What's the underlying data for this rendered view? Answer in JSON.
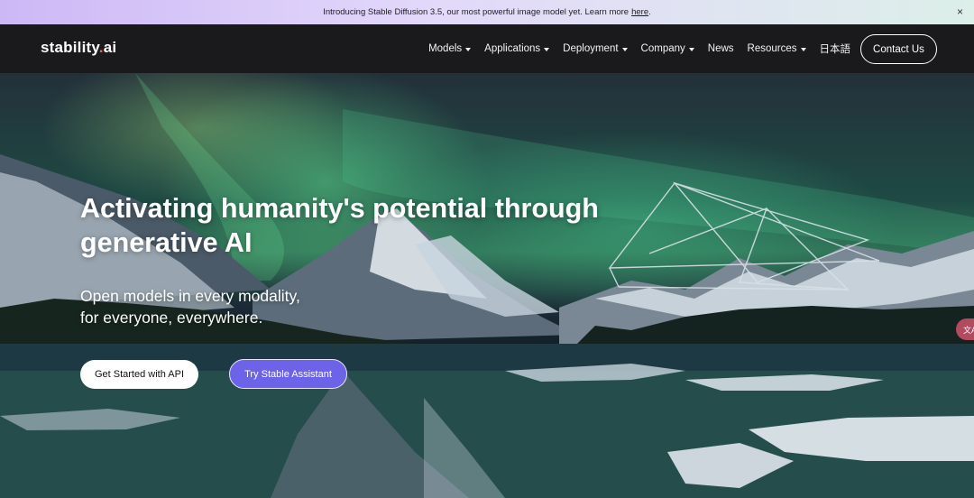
{
  "announcement": {
    "text": "Introducing Stable Diffusion 3.5, our most powerful image model yet. Learn more",
    "link": "here",
    "suffix": ".",
    "close": "×"
  },
  "nav": {
    "logo_main": "stability",
    "logo_dot": ".",
    "logo_end": "ai",
    "items": [
      {
        "label": "Models",
        "dropdown": true
      },
      {
        "label": "Applications",
        "dropdown": true
      },
      {
        "label": "Deployment",
        "dropdown": true
      },
      {
        "label": "Company",
        "dropdown": true
      },
      {
        "label": "News",
        "dropdown": false
      },
      {
        "label": "Resources",
        "dropdown": true
      },
      {
        "label": "日本語",
        "dropdown": false
      }
    ],
    "contact": "Contact Us"
  },
  "hero": {
    "headline": "Activating humanity's potential through generative AI",
    "subline_1": "Open models in every modality,",
    "subline_2": "for everyone, everywhere.",
    "cta_primary": "Get Started with API",
    "cta_secondary": "Try Stable Assistant",
    "side_tab": "文A"
  },
  "colors": {
    "accent": "#6c63e8",
    "logo_dot": "#ff5b4a",
    "nav_bg": "#1a1a1d"
  }
}
